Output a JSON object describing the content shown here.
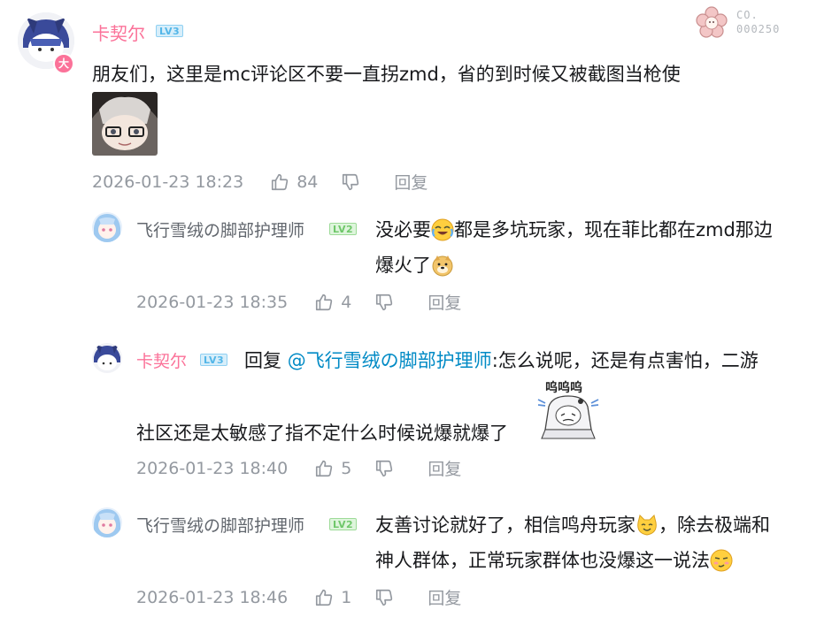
{
  "badge": {
    "prefix": "CO.",
    "number": "000250"
  },
  "comment": {
    "user": "卡契尔",
    "level": "LV3",
    "avatar_badge": "大",
    "text": "朋友们，这里是mc评论区不要一直拐zmd，省的到时候又被截图当枪使",
    "time": "2026-01-23 18:23",
    "likes": "84",
    "reply_label": "回复"
  },
  "replies": [
    {
      "user": "飞行雪绒の脚部护理师",
      "level": "LV2",
      "text_a": "没必要",
      "text_b": "都是多坑玩家，现在菲比都在zmd那边",
      "text_c": "爆火了",
      "time": "2026-01-23 18:35",
      "likes": "4",
      "reply_label": "回复"
    },
    {
      "user": "卡契尔",
      "level": "LV3",
      "reply_prefix": "回复",
      "mention": "@飞行雪绒の脚部护理师",
      "text_a": ":怎么说呢，还是有点害怕，二游",
      "text_b": "社区还是太敏感了指不定什么时候说爆就爆了",
      "sticker_caption": "呜呜呜",
      "time": "2026-01-23 18:40",
      "likes": "5",
      "reply_label": "回复"
    },
    {
      "user": "飞行雪绒の脚部护理师",
      "level": "LV2",
      "text_a": "友善讨论就好了，相信鸣舟玩家",
      "text_b": "，除去极端和",
      "text_c": "神人群体，正常玩家群体也没爆这一说法",
      "time": "2026-01-23 18:46",
      "likes": "1",
      "reply_label": "回复"
    }
  ],
  "colors": {
    "pink": "#fb7299",
    "gray": "#9499a0",
    "link": "#008ac5"
  },
  "icons": [
    "like-icon",
    "dislike-icon",
    "flower-badge-icon",
    "laugh-cry-emoji",
    "doge-emoji",
    "cat-emoji",
    "smirk-emoji"
  ]
}
